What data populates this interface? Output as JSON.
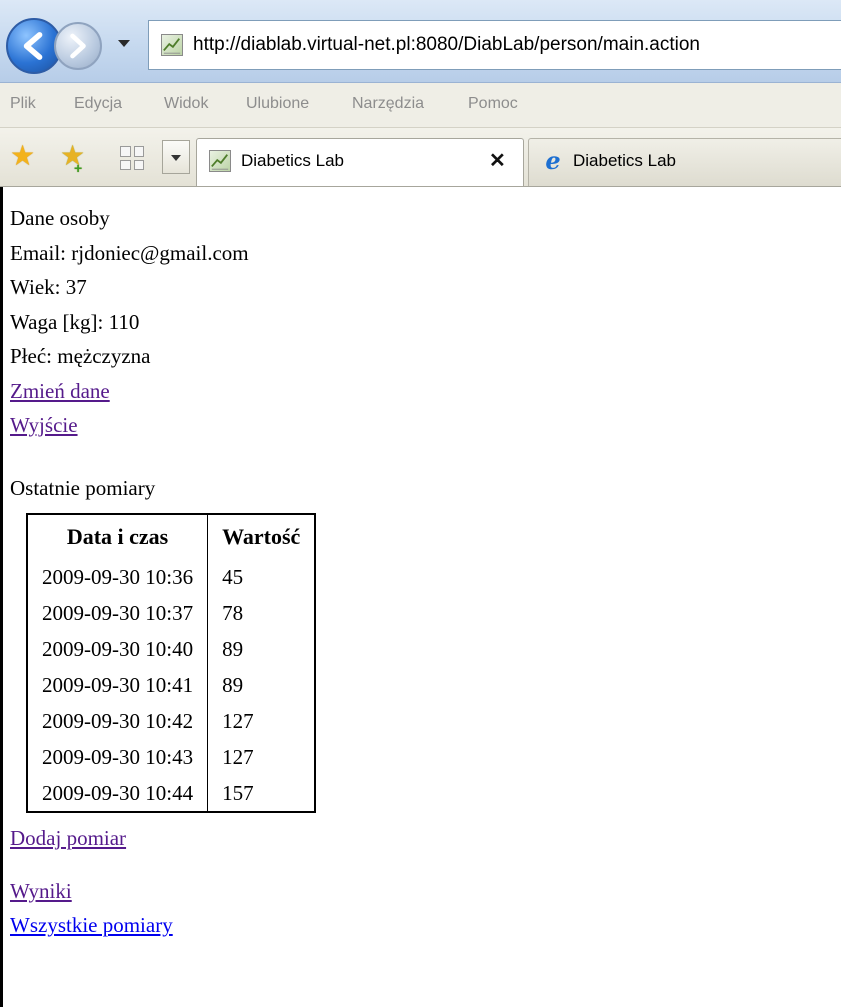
{
  "browser": {
    "address": "http://diablab.virtual-net.pl:8080/DiabLab/person/main.action",
    "menu": [
      "Plik",
      "Edycja",
      "Widok",
      "Ulubione",
      "Narzędzia",
      "Pomoc"
    ],
    "tabs": [
      {
        "title": "Diabetics Lab",
        "active": true,
        "close_label": "✕"
      },
      {
        "title": "Diabetics Lab",
        "active": false
      }
    ],
    "icons": {
      "back": "back-arrow-icon",
      "forward": "forward-arrow-icon",
      "favorites": "favorites-star-icon",
      "add_favorite": "add-favorite-star-icon",
      "quick_tabs": "quick-tabs-grid-icon"
    }
  },
  "person": {
    "heading": "Dane osoby",
    "email": "Email: rjdoniec@gmail.com",
    "age": "Wiek: 37",
    "weight": "Waga [kg]: 110",
    "gender": "Płeć: mężczyzna",
    "edit_link": "Zmień dane",
    "logout_link": "Wyjście"
  },
  "measurements": {
    "heading": "Ostatnie pomiary",
    "columns": [
      "Data i czas",
      "Wartość"
    ],
    "rows": [
      [
        "2009-09-30 10:36",
        "45"
      ],
      [
        "2009-09-30 10:37",
        "78"
      ],
      [
        "2009-09-30 10:40",
        "89"
      ],
      [
        "2009-09-30 10:41",
        "89"
      ],
      [
        "2009-09-30 10:42",
        "127"
      ],
      [
        "2009-09-30 10:43",
        "127"
      ],
      [
        "2009-09-30 10:44",
        "157"
      ]
    ],
    "add_link": "Dodaj pomiar"
  },
  "links": {
    "results": "Wyniki",
    "all_measurements": "Wszystkie pomiary"
  }
}
